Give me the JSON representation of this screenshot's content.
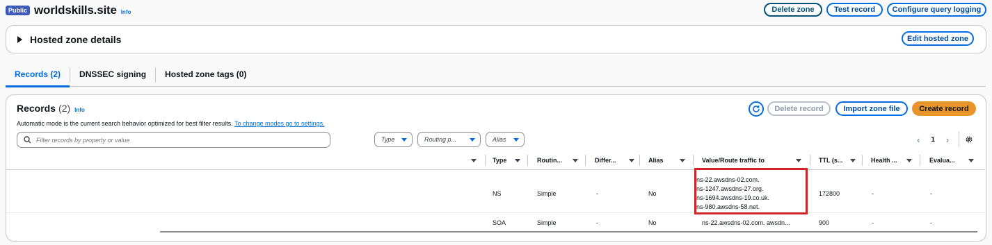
{
  "header": {
    "badge": "Public",
    "zone_name": "worldskills.site",
    "info": "Info",
    "buttons": {
      "delete_zone": "Delete zone",
      "test_record": "Test record",
      "configure_query_logging": "Configure query logging"
    }
  },
  "hosted_zone_details": {
    "title": "Hosted zone details",
    "edit_button": "Edit hosted zone"
  },
  "tabs": [
    {
      "label": "Records (2)",
      "active": true
    },
    {
      "label": "DNSSEC signing",
      "active": false
    },
    {
      "label": "Hosted zone tags (0)",
      "active": false
    }
  ],
  "records": {
    "title": "Records",
    "count": "(2)",
    "info": "Info",
    "description": "Automatic mode is the current search behavior optimized for best filter results.",
    "description_link": "To change modes go to settings.",
    "buttons": {
      "delete_record": "Delete record",
      "import_zone_file": "Import zone file",
      "create_record": "Create record"
    },
    "search_placeholder": "Filter records by property or value",
    "filters": {
      "type": "Type",
      "routing": "Routing p...",
      "alias": "Alias"
    },
    "page": "1",
    "columns": [
      "Type",
      "Routin...",
      "Differ...",
      "Alias",
      "Value/Route traffic to",
      "TTL (s...",
      "Health ...",
      "Evalua..."
    ],
    "rows": [
      {
        "type": "NS",
        "routing": "Simple",
        "differ": "-",
        "alias": "No",
        "values": [
          "ns-22.awsdns-02.com.",
          "ns-1247.awsdns-27.org.",
          "ns-1694.awsdns-19.co.uk.",
          "ns-980.awsdns-58.net."
        ],
        "ttl": "172800",
        "health": "-",
        "evaluate": "-"
      },
      {
        "type": "SOA",
        "routing": "Simple",
        "differ": "-",
        "alias": "No",
        "value": "ns-22.awsdns-02.com. awsdn...",
        "ttl": "900",
        "health": "-",
        "evaluate": "-"
      }
    ]
  },
  "colors": {
    "primary": "#e8952b",
    "link": "#0972d3",
    "highlight": "#d0232a",
    "badge": "#3d5ab8"
  }
}
